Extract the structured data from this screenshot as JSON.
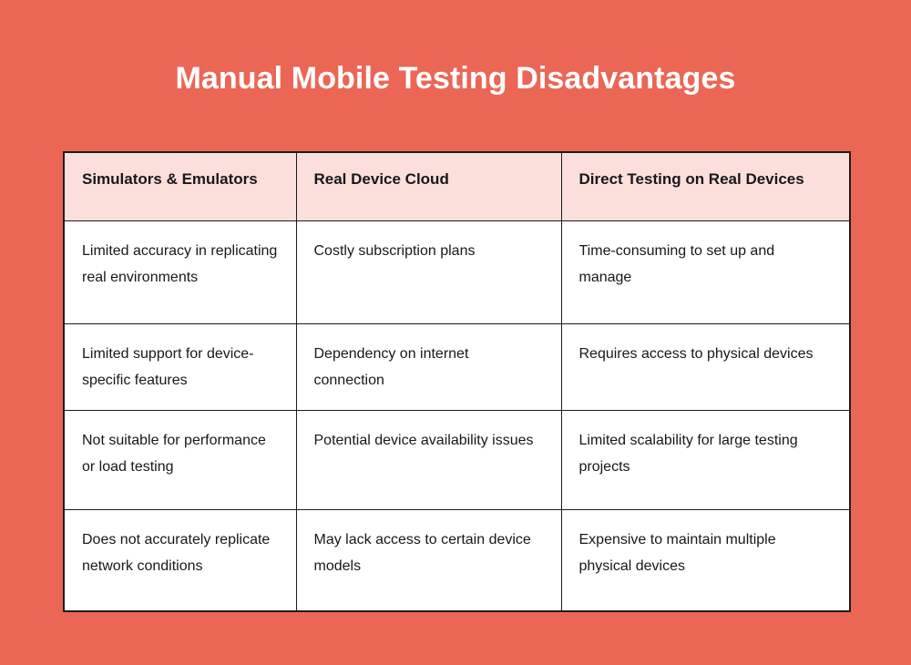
{
  "theme": {
    "background_color": "#ec6655",
    "title_color": "#ffffff",
    "header_cell_color": "#fbdfdb",
    "body_cell_color": "#ffffff",
    "border_color": "#1c1c1c",
    "text_color": "#16181a"
  },
  "header": {
    "title": "Manual Mobile Testing Disadvantages"
  },
  "table": {
    "columns": [
      {
        "label": "Simulators & Emulators"
      },
      {
        "label": "Real Device Cloud"
      },
      {
        "label": "Direct Testing on Real Devices"
      }
    ],
    "rows": [
      {
        "cells": [
          "Limited accuracy in replicating real environments",
          "Costly subscription plans",
          "Time-consuming to set up and manage"
        ]
      },
      {
        "cells": [
          "Limited support for device-specific features",
          "Dependency on internet connection",
          "Requires access to physical devices"
        ]
      },
      {
        "cells": [
          "Not suitable for performance or load testing",
          "Potential device availability issues",
          "Limited scalability for large testing projects"
        ]
      },
      {
        "cells": [
          "Does not accurately replicate network conditions",
          "May lack access to certain device models",
          "Expensive to maintain multiple physical devices"
        ]
      }
    ]
  }
}
